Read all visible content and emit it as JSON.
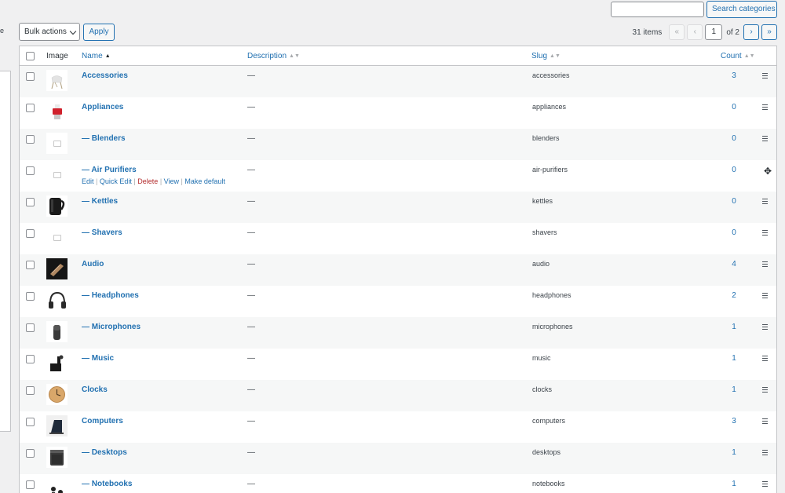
{
  "search": {
    "placeholder": "",
    "button_label": "Search categories"
  },
  "toolbar": {
    "bulk_label": "Bulk actions",
    "apply_label": "Apply"
  },
  "left_edge": "e",
  "pagination": {
    "items": "31 items",
    "first": "«",
    "prev": "‹",
    "current_page": "1",
    "of": "of 2",
    "next": "›",
    "last": "»"
  },
  "columns": {
    "image": "Image",
    "name": "Name",
    "description": "Description",
    "slug": "Slug",
    "count": "Count"
  },
  "row_actions": {
    "edit": "Edit",
    "quick_edit": "Quick Edit",
    "delete": "Delete",
    "view": "View",
    "make_default": "Make default",
    "sep": "|"
  },
  "rows": [
    {
      "name": "Accessories",
      "desc": "—",
      "slug": "accessories",
      "count": "3",
      "thumb": "chair-image"
    },
    {
      "name": "Appliances",
      "desc": "—",
      "slug": "appliances",
      "count": "0",
      "thumb": "appliance-image"
    },
    {
      "name": "— Blenders",
      "desc": "—",
      "slug": "blenders",
      "count": "0",
      "thumb": "placeholder-image"
    },
    {
      "name": "— Air Purifiers",
      "desc": "—",
      "slug": "air-purifiers",
      "count": "0",
      "thumb": "placeholder-image",
      "hover": true
    },
    {
      "name": "— Kettles",
      "desc": "—",
      "slug": "kettles",
      "count": "0",
      "thumb": "kettle-image"
    },
    {
      "name": "— Shavers",
      "desc": "—",
      "slug": "shavers",
      "count": "0",
      "thumb": "placeholder-image"
    },
    {
      "name": "Audio",
      "desc": "—",
      "slug": "audio",
      "count": "4",
      "thumb": "audio-image"
    },
    {
      "name": "— Headphones",
      "desc": "—",
      "slug": "headphones",
      "count": "2",
      "thumb": "headphones-image"
    },
    {
      "name": "— Microphones",
      "desc": "—",
      "slug": "microphones",
      "count": "1",
      "thumb": "microphone-image"
    },
    {
      "name": "— Music",
      "desc": "—",
      "slug": "music",
      "count": "1",
      "thumb": "music-image"
    },
    {
      "name": "Clocks",
      "desc": "—",
      "slug": "clocks",
      "count": "1",
      "thumb": "clock-image"
    },
    {
      "name": "Computers",
      "desc": "—",
      "slug": "computers",
      "count": "3",
      "thumb": "computer-image"
    },
    {
      "name": "— Desktops",
      "desc": "—",
      "slug": "desktops",
      "count": "1",
      "thumb": "desktop-image"
    },
    {
      "name": "— Notebooks",
      "desc": "—",
      "slug": "notebooks",
      "count": "1",
      "thumb": "notebook-image"
    }
  ]
}
